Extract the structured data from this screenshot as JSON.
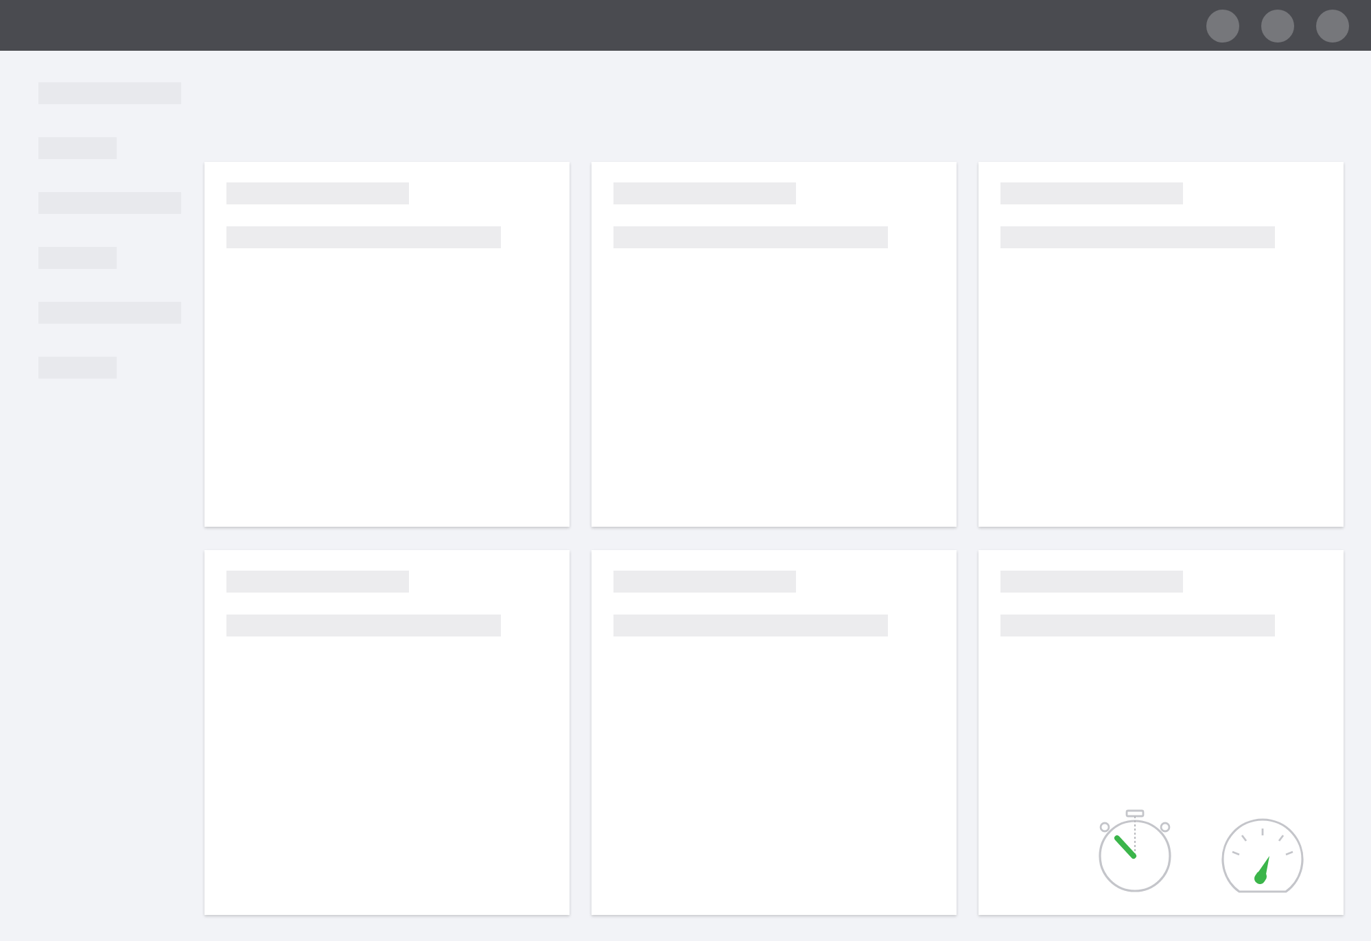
{
  "window": {
    "controls": [
      {
        "kind": "dot"
      },
      {
        "kind": "dot"
      },
      {
        "kind": "dot"
      }
    ]
  },
  "sidebar": {
    "items": [
      {
        "kind": "long"
      },
      {
        "kind": "short"
      },
      {
        "kind": "long"
      },
      {
        "kind": "short"
      },
      {
        "kind": "long"
      },
      {
        "kind": "short"
      }
    ]
  },
  "cards": [
    {
      "kind": "placeholder"
    },
    {
      "kind": "placeholder"
    },
    {
      "kind": "placeholder"
    },
    {
      "kind": "placeholder"
    },
    {
      "kind": "placeholder"
    },
    {
      "kind": "meters"
    }
  ]
}
